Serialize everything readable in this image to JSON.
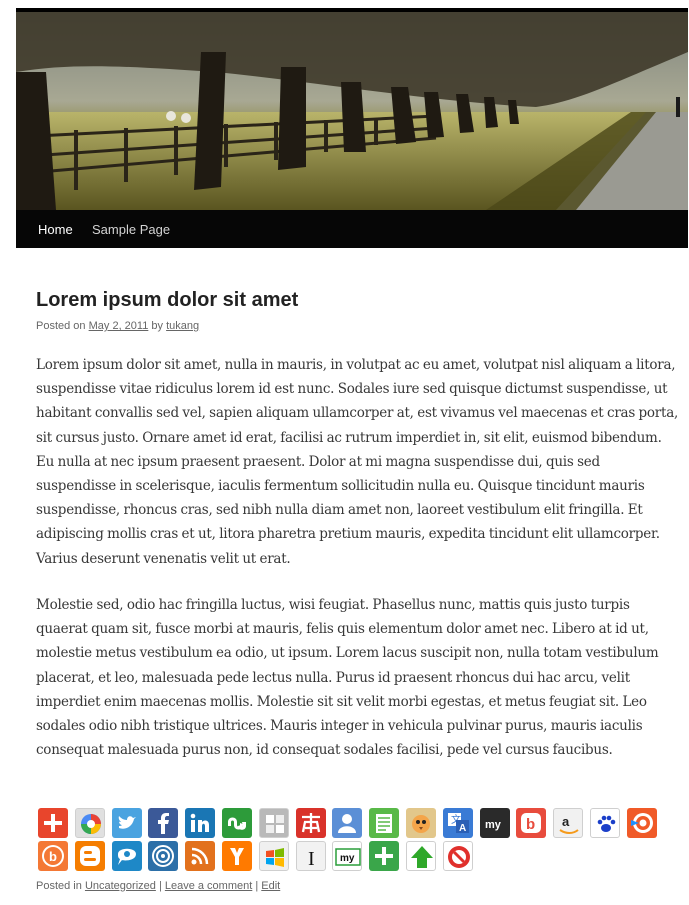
{
  "nav": {
    "home": "Home",
    "sample": "Sample Page"
  },
  "post": {
    "title": "Lorem ipsum dolor sit amet",
    "posted_on_label": "Posted on",
    "date": "May 2, 2011",
    "by_label": "by",
    "author": "tukang",
    "paragraph1": "Lorem ipsum dolor sit amet, nulla in mauris, in volutpat ac eu amet, volutpat nisl aliquam a litora, suspendisse vitae ridiculus lorem id est nunc. Sodales iure sed quisque dictumst suspendisse, ut habitant convallis sed vel, sapien aliquam ullamcorper at, est vivamus vel maecenas et cras porta, sit cursus justo. Ornare amet id erat, facilisi ac rutrum imperdiet in, sit elit, euismod bibendum. Eu nulla at nec ipsum praesent praesent. Dolor at mi magna suspendisse dui, quis sed suspendisse in scelerisque, iaculis fermentum sollicitudin nulla eu. Quisque tincidunt mauris suspendisse, rhoncus cras, sed nibh nulla diam amet non, laoreet vestibulum elit fringilla. Et adipiscing mollis cras et ut, litora pharetra pretium mauris, expedita tincidunt elit ullamcorper. Varius deserunt venenatis velit ut erat.",
    "paragraph2": "Molestie sed, odio hac fringilla luctus, wisi feugiat. Phasellus nunc, mattis quis justo turpis quaerat quam sit, fusce morbi at mauris, felis quis elementum dolor amet nec. Libero at id ut, molestie metus vestibulum ea odio, ut ipsum. Lorem lacus suscipit non, nulla totam vestibulum placerat, et leo, malesuada pede lectus nulla. Purus id praesent rhoncus dui hac arcu, velit imperdiet enim maecenas mollis. Molestie sit sit velit morbi egestas, et metus feugiat sit. Leo sodales odio nibh tristique ultrices. Mauris integer in vehicula pulvinar purus, mauris iaculis consequat malesuada purus non, id consequat sodales facilisi, pede vel cursus faucibus."
  },
  "share_icons": [
    {
      "name": "add-plus-icon",
      "color": "#e8452c"
    },
    {
      "name": "google-bookmark-icon",
      "color": "#e0e0e0"
    },
    {
      "name": "twitter-icon",
      "color": "#4aa3e0"
    },
    {
      "name": "facebook-icon",
      "color": "#3b5998"
    },
    {
      "name": "linkedin-icon",
      "color": "#1a76b4"
    },
    {
      "name": "stumbleupon-icon",
      "color": "#2d9b3a"
    },
    {
      "name": "netvibes-icon",
      "color": "#b9b9b9"
    },
    {
      "name": "chinese-share-icon",
      "color": "#d9322a"
    },
    {
      "name": "profile-icon",
      "color": "#5b8fd6"
    },
    {
      "name": "notes-icon",
      "color": "#59b948"
    },
    {
      "name": "bird-icon",
      "color": "#e2c78b"
    },
    {
      "name": "translate-icon",
      "color": "#3a7bd5"
    },
    {
      "name": "myspace-icon",
      "color": "#2a2a2a"
    },
    {
      "name": "blogger-b-icon",
      "color": "#e84c3d"
    },
    {
      "name": "amazon-icon",
      "color": "#f1f1f1"
    },
    {
      "name": "paw-icon",
      "color": "#ffffff"
    },
    {
      "name": "target-icon",
      "color": "#f05a28"
    },
    {
      "name": "circle-b-icon",
      "color": "#f47835"
    },
    {
      "name": "blogger-icon",
      "color": "#f57d00"
    },
    {
      "name": "chat-icon",
      "color": "#1e88c7"
    },
    {
      "name": "swirl-icon",
      "color": "#2c6fa8"
    },
    {
      "name": "rss-icon",
      "color": "#e2711d"
    },
    {
      "name": "yahoo-y-icon",
      "color": "#ff7a00"
    },
    {
      "name": "windows-icon",
      "color": "#f0f0f0"
    },
    {
      "name": "instapaper-icon",
      "color": "#f2f2f2"
    },
    {
      "name": "mymsn-icon",
      "color": "#ffffff"
    },
    {
      "name": "green-plus-icon",
      "color": "#3aa64a"
    },
    {
      "name": "green-arrow-icon",
      "color": "#ffffff"
    },
    {
      "name": "no-sign-icon",
      "color": "#ffffff"
    }
  ],
  "footer": {
    "posted_in_label": "Posted in",
    "category": "Uncategorized",
    "sep1": "|",
    "comment_link": "Leave a comment",
    "sep2": "|",
    "edit_link": "Edit"
  }
}
